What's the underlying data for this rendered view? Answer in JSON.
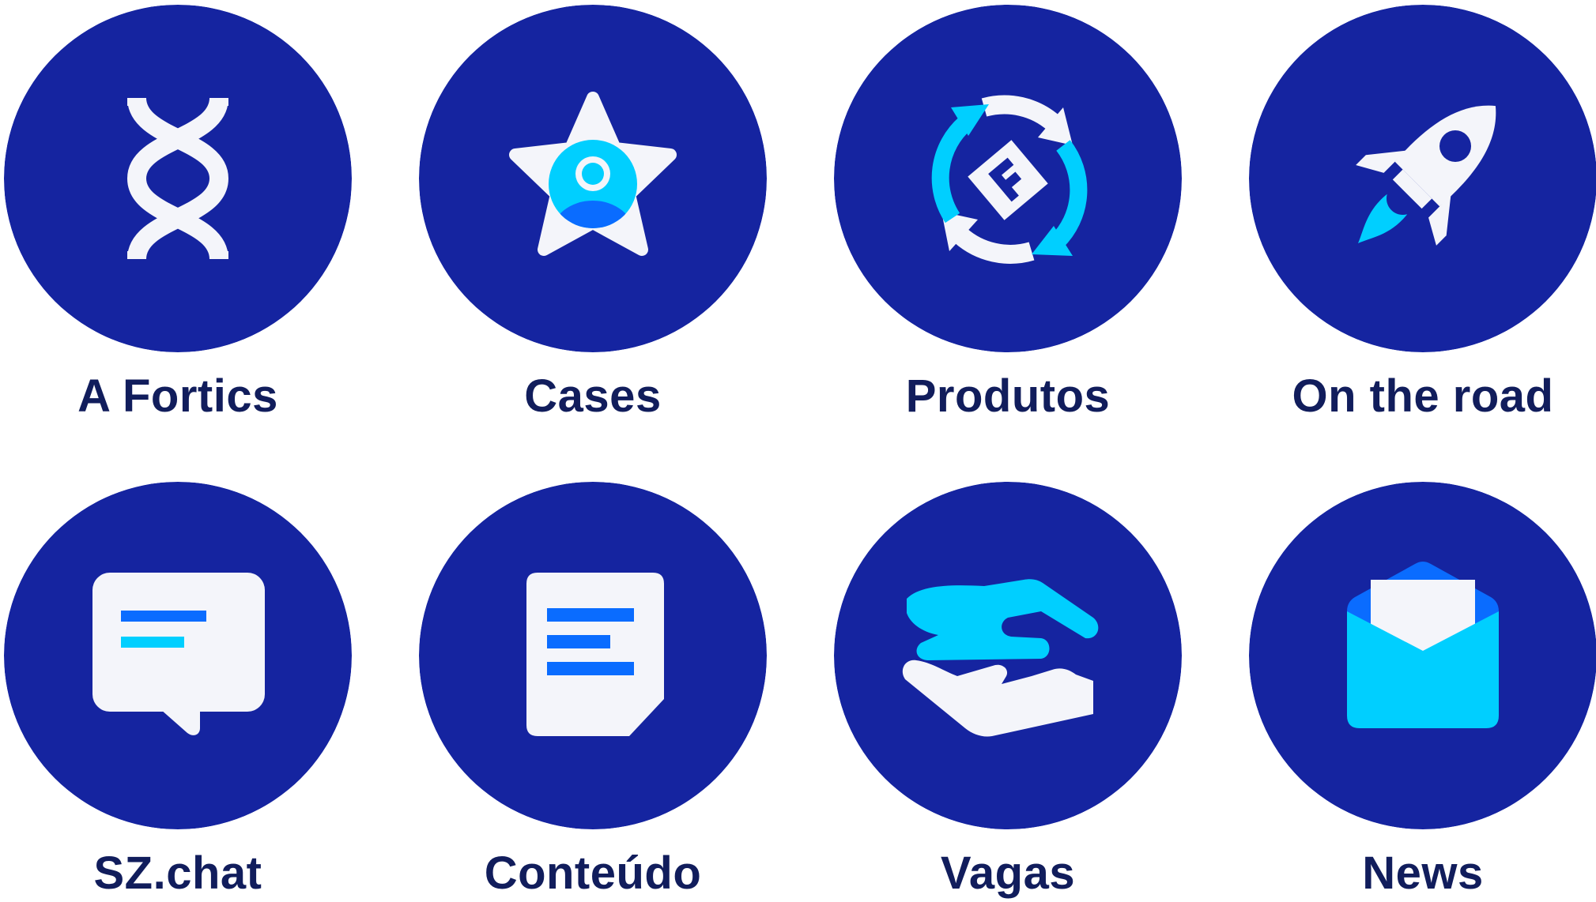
{
  "colors": {
    "circle": "#1524a0",
    "label": "#111d5c",
    "icon_light": "#f4f5fa",
    "accent_cyan": "#00cfff",
    "accent_blue": "#0a6cff"
  },
  "menu": {
    "items": [
      {
        "label": "A Fortics",
        "icon": "dna-icon"
      },
      {
        "label": "Cases",
        "icon": "star-user-icon"
      },
      {
        "label": "Produtos",
        "icon": "product-cycle-icon"
      },
      {
        "label": "On the road",
        "icon": "rocket-icon"
      },
      {
        "label": "SZ.chat",
        "icon": "chat-bubble-icon"
      },
      {
        "label": "Conteúdo",
        "icon": "document-icon"
      },
      {
        "label": "Vagas",
        "icon": "handshake-icon"
      },
      {
        "label": "News",
        "icon": "envelope-icon"
      }
    ]
  }
}
